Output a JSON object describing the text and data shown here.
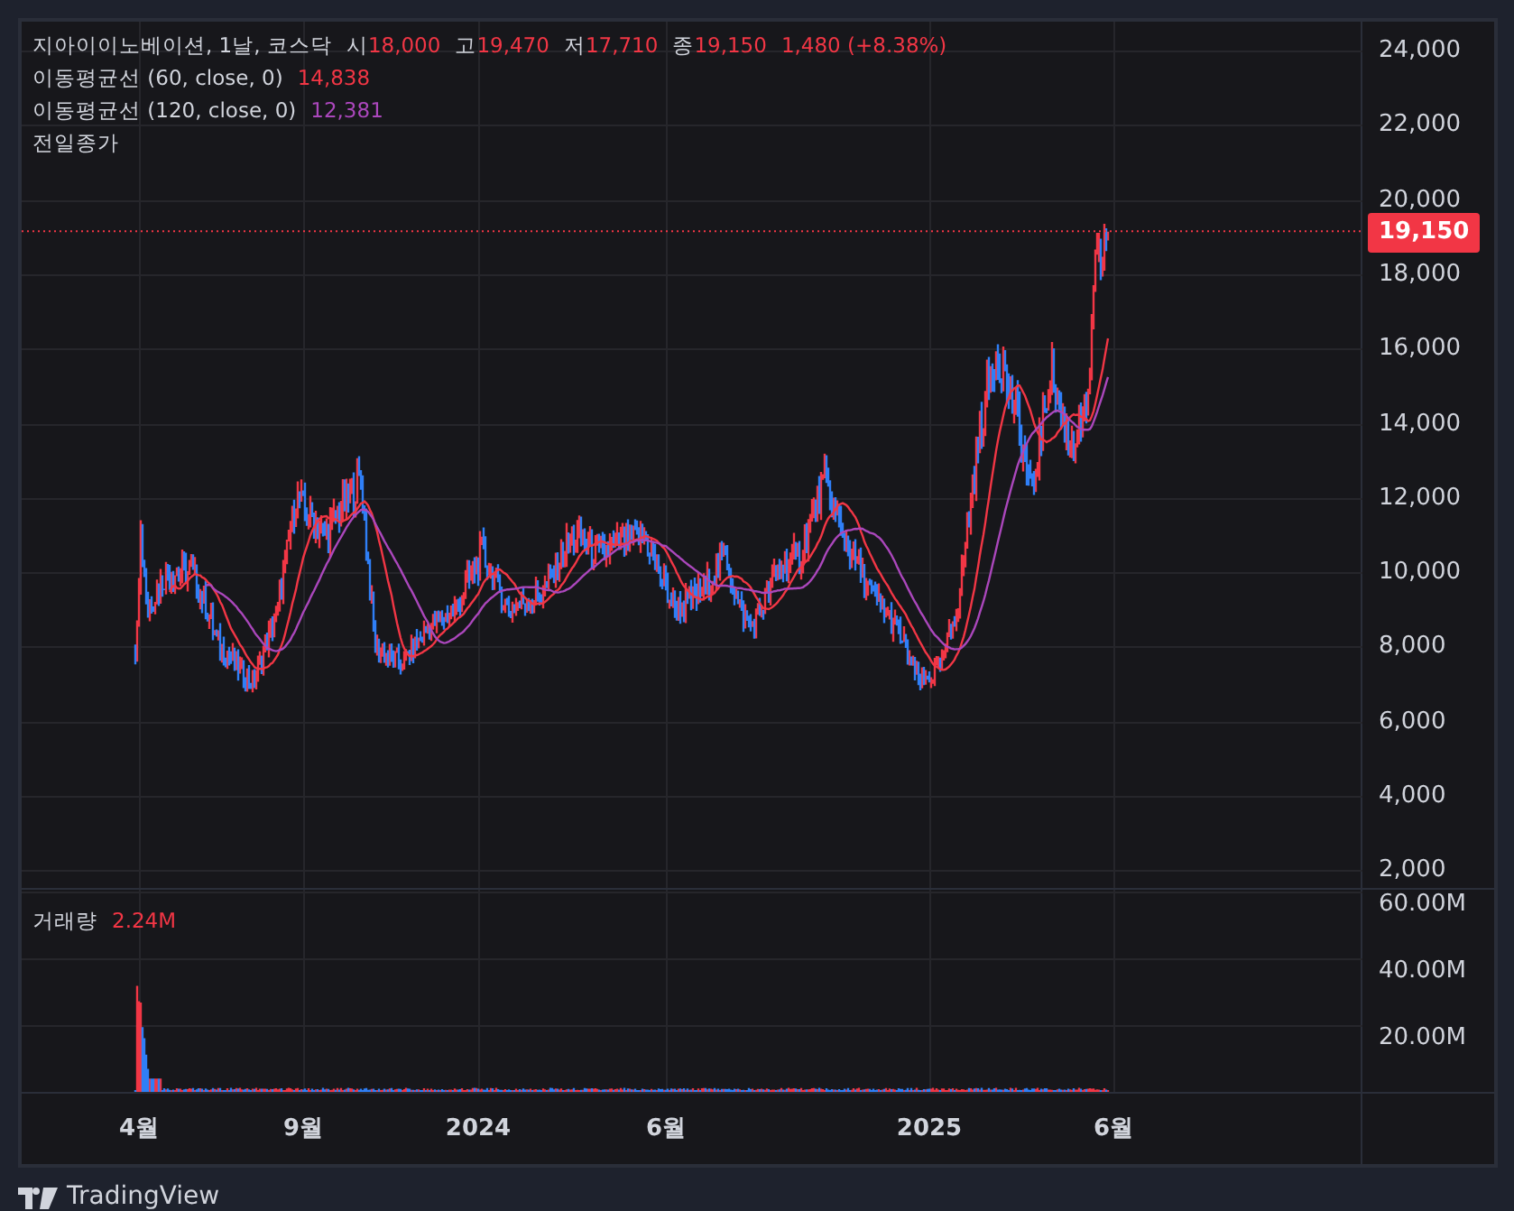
{
  "legend": {
    "symbol": "지아이이노베이션, 1날, 코스닥",
    "ohlc": [
      {
        "label": "시",
        "value": "18,000"
      },
      {
        "label": "고",
        "value": "19,470"
      },
      {
        "label": "저",
        "value": "17,710"
      },
      {
        "label": "종",
        "value": "19,150"
      }
    ],
    "change": "1,480 (+8.38%)"
  },
  "indicators": [
    {
      "name": "이동평균선 (60, close, 0)",
      "value": "14,838",
      "color": "#f23645"
    },
    {
      "name": "이동평균선 (120, close, 0)",
      "value": "12,381",
      "color": "#ab47bc"
    }
  ],
  "prev_close_label": "전일종가",
  "price_axis": [
    "24,000",
    "22,000",
    "20,000",
    "18,000",
    "16,000",
    "14,000",
    "12,000",
    "10,000",
    "8,000",
    "6,000",
    "4,000",
    "2,000"
  ],
  "last_price": "19,150",
  "volume": {
    "label": "거래량",
    "value": "2.24M",
    "axis": [
      "60.00M",
      "40.00M",
      "20.00M"
    ]
  },
  "time_axis": [
    "4월",
    "9월",
    "2024",
    "6월",
    "2025",
    "6월"
  ],
  "brand": "TradingView"
}
